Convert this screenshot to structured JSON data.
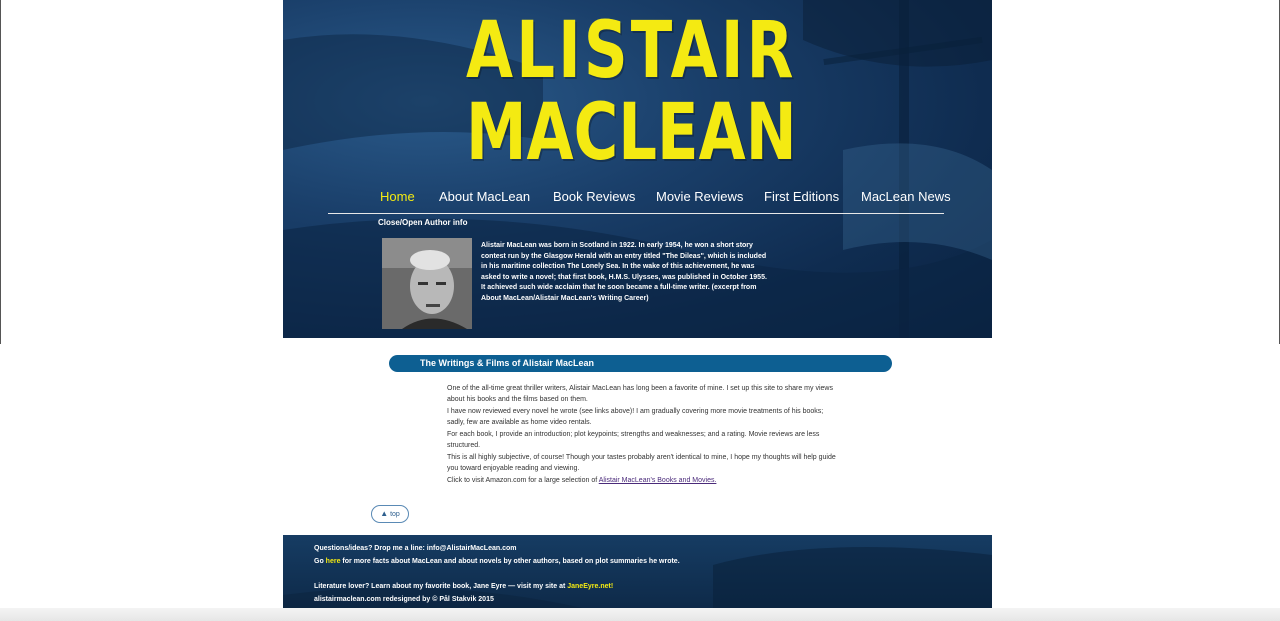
{
  "logo": {
    "line1": "ALISTAIR",
    "line2": "MACLEAN"
  },
  "nav": {
    "items": [
      {
        "label": "Home",
        "active": true
      },
      {
        "label": "About MacLean",
        "active": false
      },
      {
        "label": "Book Reviews",
        "active": false
      },
      {
        "label": "Movie Reviews",
        "active": false
      },
      {
        "label": "First Editions",
        "active": false
      },
      {
        "label": "MacLean News",
        "active": false
      }
    ]
  },
  "author": {
    "toggle_label": "Close/Open Author info",
    "bio": "Alistair MacLean was born in Scotland in 1922. In early 1954, he won a short story contest run by the Glasgow Herald with an entry titled \"The Dileas\", which is included in his maritime collection The Lonely Sea. In the wake of this achievement, he was asked to write a novel; that first book, H.M.S. Ulysses, was published in October 1955. It achieved such wide acclaim that he soon became a full-time writer. (excerpt from About MacLean/Alistair MacLean's Writing Career)"
  },
  "main": {
    "banner_title": "The Writings & Films of Alistair MacLean",
    "paragraphs": [
      "One of the all-time great thriller writers, Alistair MacLean has long been a favorite of mine. I set up this site to share my views about his books and the films based on them.",
      "I have now reviewed every novel he wrote (see links above)! I am gradually covering more movie treatments of his books; sadly, few are available as home video rentals.",
      "For each book, I provide an introduction; plot keypoints; strengths and weaknesses; and a rating. Movie reviews are less structured.",
      "This is all highly subjective, of course! Though your tastes probably aren't identical to mine, I hope my thoughts will help guide you toward enjoyable reading and viewing."
    ],
    "amazon_prefix": "Click to visit Amazon.com for a large selection of ",
    "amazon_link": "Alistair MacLean's Books and Movies.",
    "top_label": "top"
  },
  "footer": {
    "contact": "Questions/ideas? Drop me a line: info@AlistairMacLean.com",
    "go_prefix": "Go ",
    "go_link": "here",
    "go_suffix": " for more facts about MacLean and about novels by other authors, based on plot summaries he wrote.",
    "lit_prefix": "Literature lover? Learn about my favorite book, Jane Eyre — visit my site at ",
    "lit_link": "JaneEyre.net!",
    "credit": "alistairmaclean.com redesigned by © Pål Stakvik 2015"
  },
  "colors": {
    "accent": "#f4ea12",
    "banner": "#0d5f92",
    "header_bg": "#1a3f6a"
  },
  "icons": {
    "top": "triangle-up-icon"
  }
}
